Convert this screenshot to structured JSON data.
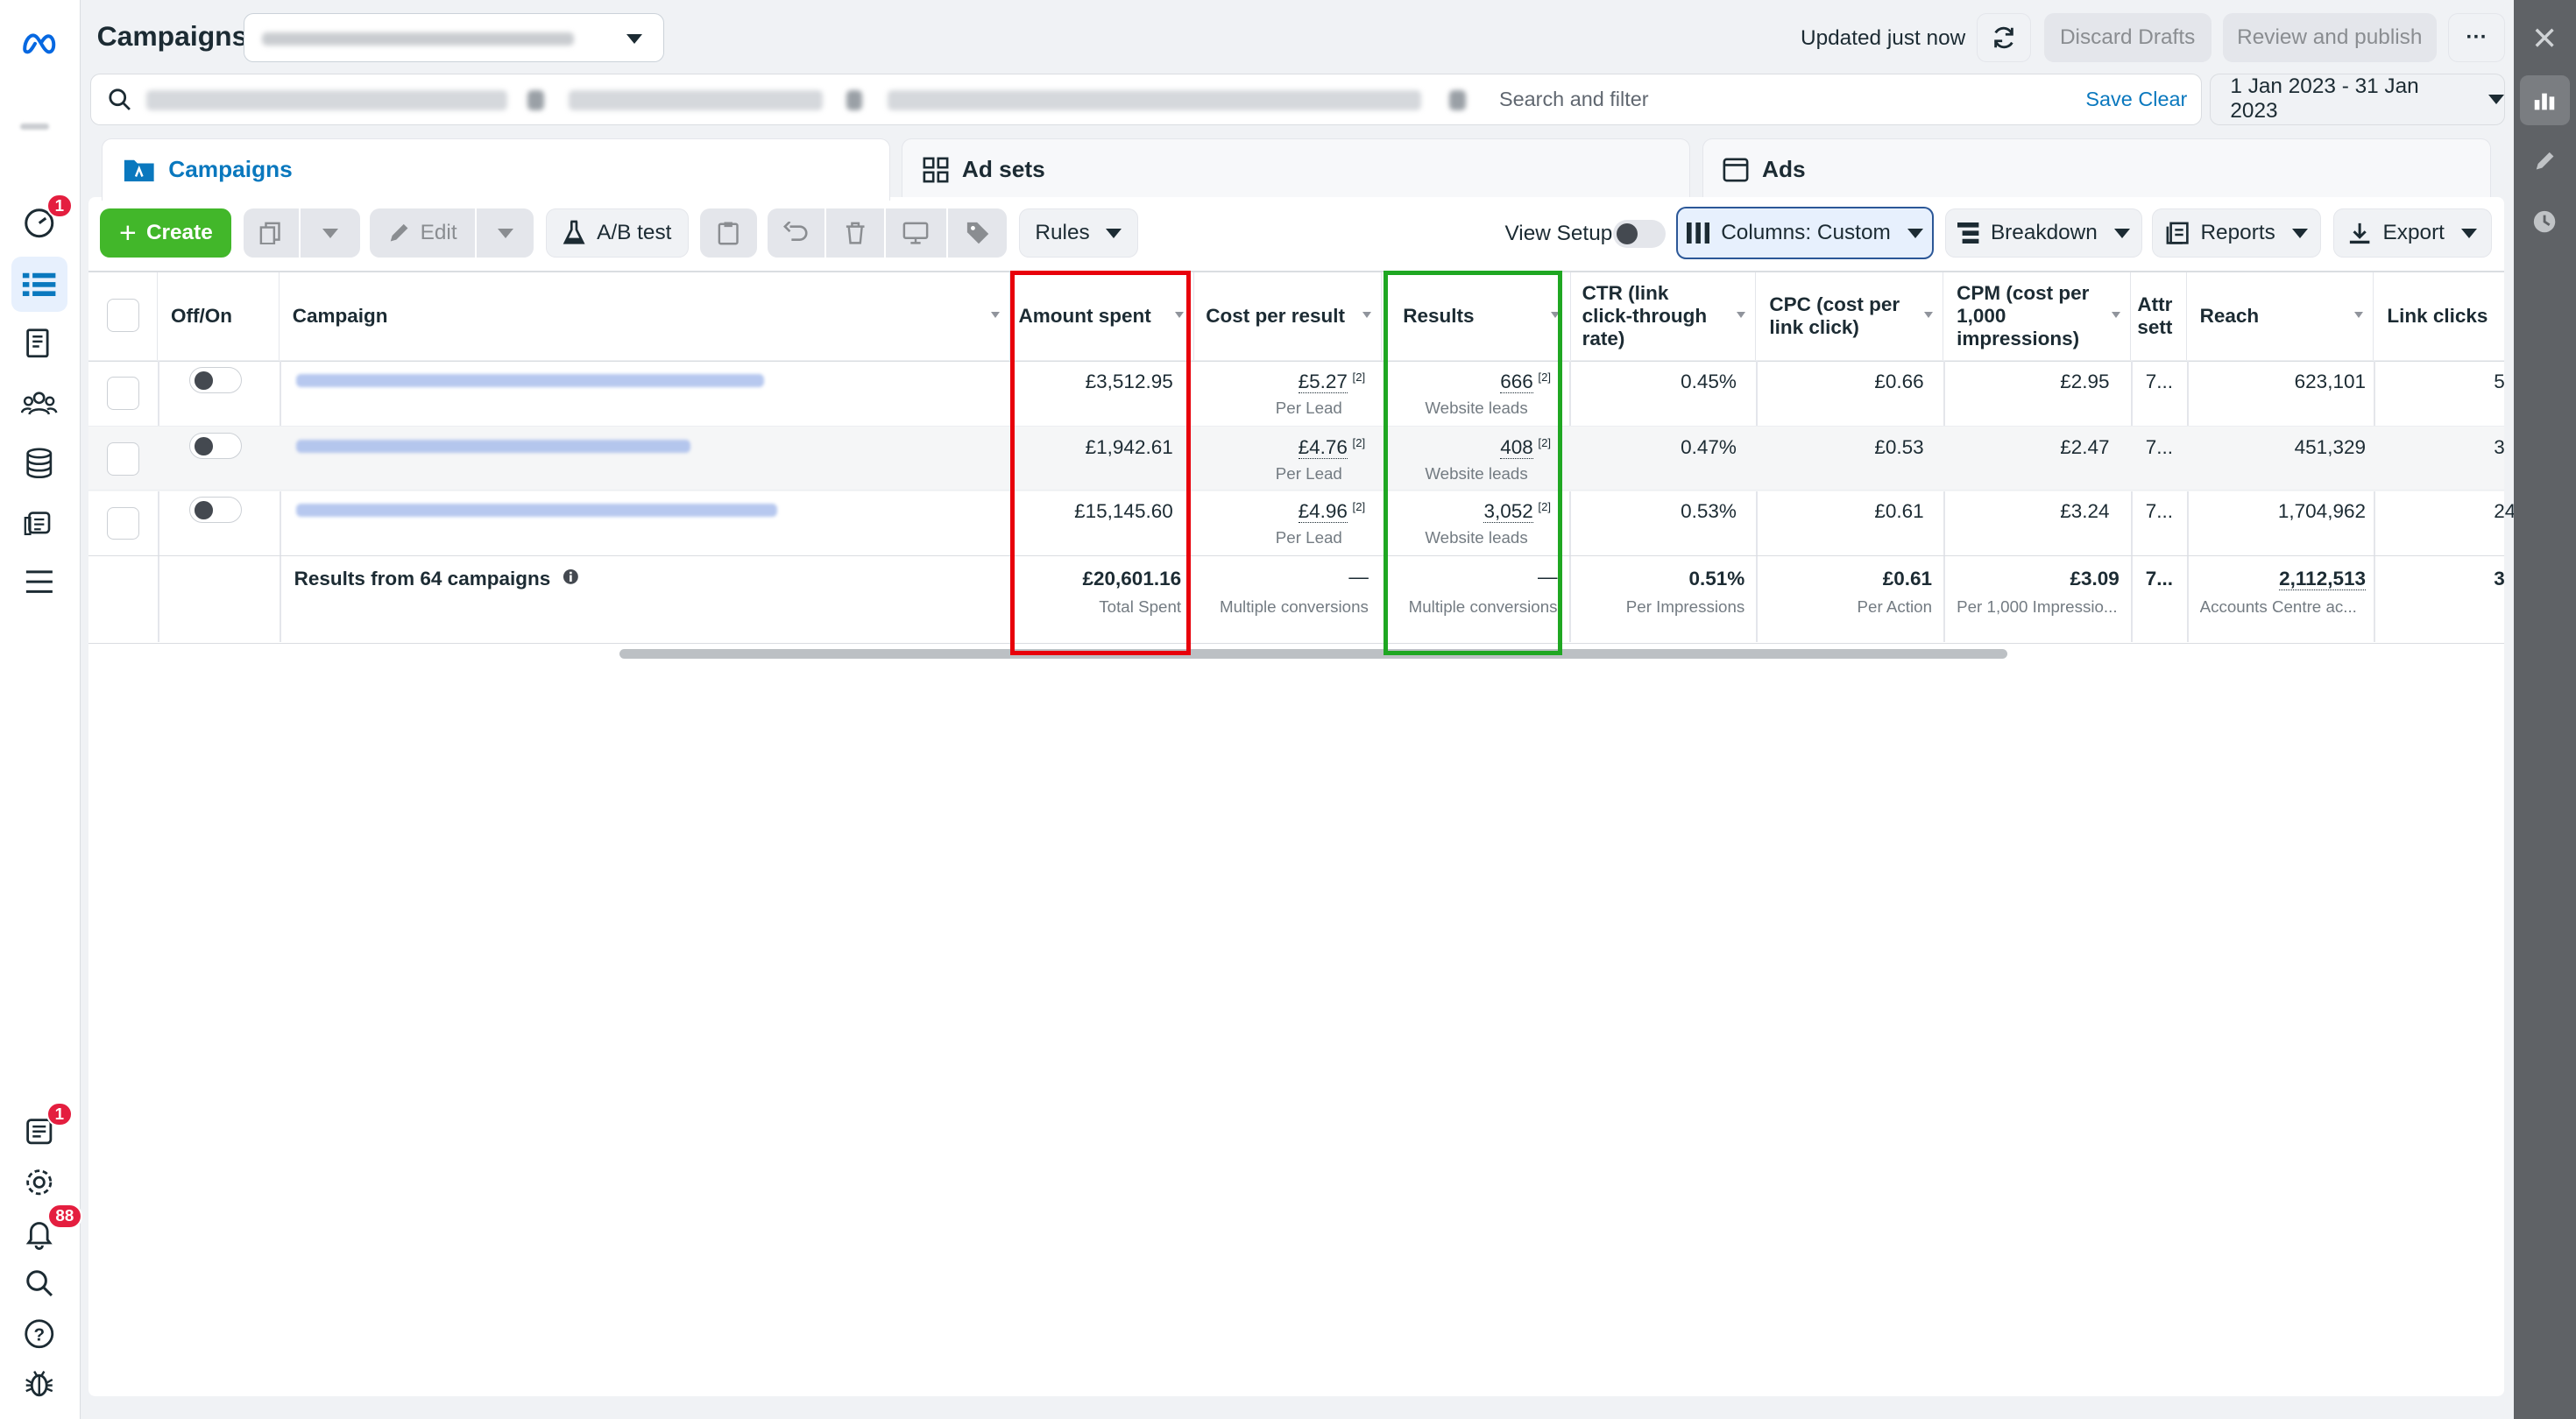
{
  "header": {
    "title": "Campaigns",
    "updated": "Updated just now",
    "discard": "Discard Drafts",
    "review": "Review and publish",
    "more": "···"
  },
  "search": {
    "placeholder": "Search and filter",
    "save": "Save",
    "clear": "Clear",
    "date_range": "1 Jan 2023 - 31 Jan 2023"
  },
  "tabs": {
    "campaigns": "Campaigns",
    "adsets": "Ad sets",
    "ads": "Ads"
  },
  "toolbar": {
    "create": "Create",
    "edit": "Edit",
    "ab_test": "A/B test",
    "rules": "Rules",
    "view_setup": "View Setup",
    "columns": "Columns: Custom",
    "breakdown": "Breakdown",
    "reports": "Reports",
    "export": "Export"
  },
  "table": {
    "headers": {
      "offon": "Off/On",
      "campaign": "Campaign",
      "amount": "Amount spent",
      "cpr": "Cost per result",
      "results": "Results",
      "ctr": "CTR (link click-through rate)",
      "cpc": "CPC (cost per link click)",
      "cpm": "CPM (cost per 1,000 impressions)",
      "attr": "Attr sett",
      "reach": "Reach",
      "clicks": "Link clicks"
    },
    "rows": [
      {
        "amount": "£3,512.95",
        "cpr": "£5.27",
        "cpr_sub": "Per Lead",
        "results": "666",
        "results_sub": "Website leads",
        "ctr": "0.45%",
        "cpc": "£0.66",
        "cpm": "£2.95",
        "attr": "7...",
        "reach": "623,101",
        "clicks": "5"
      },
      {
        "amount": "£1,942.61",
        "cpr": "£4.76",
        "cpr_sub": "Per Lead",
        "results": "408",
        "results_sub": "Website leads",
        "ctr": "0.47%",
        "cpc": "£0.53",
        "cpm": "£2.47",
        "attr": "7...",
        "reach": "451,329",
        "clicks": "3"
      },
      {
        "amount": "£15,145.60",
        "cpr": "£4.96",
        "cpr_sub": "Per Lead",
        "results": "3,052",
        "results_sub": "Website leads",
        "ctr": "0.53%",
        "cpc": "£0.61",
        "cpm": "£3.24",
        "attr": "7...",
        "reach": "1,704,962",
        "clicks": "24"
      }
    ],
    "sup": "[2]",
    "summary": {
      "label": "Results from 64 campaigns",
      "amount": "£20,601.16",
      "amount_sub": "Total Spent",
      "cpr": "—",
      "cpr_sub": "Multiple conversions",
      "results": "—",
      "results_sub": "Multiple conversions",
      "ctr": "0.51%",
      "ctr_sub": "Per Impressions",
      "cpc": "£0.61",
      "cpc_sub": "Per Action",
      "cpm": "£3.09",
      "cpm_sub": "Per 1,000 Impressio...",
      "attr": "7...",
      "reach": "2,112,513",
      "reach_sub": "Accounts Centre ac...",
      "clicks": "3"
    }
  },
  "badges": {
    "alerts": "1",
    "pages": "1",
    "notifications": "88"
  },
  "colors": {
    "accent": "#0a78be",
    "create": "#42b72a",
    "red_box": "#e8000b",
    "green_box": "#1fa722"
  }
}
